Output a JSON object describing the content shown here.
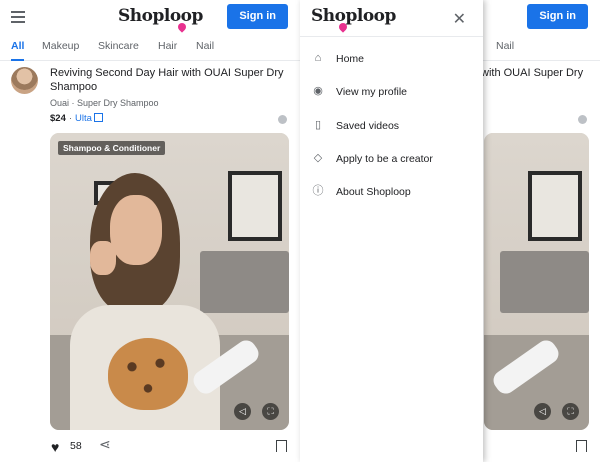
{
  "brand": {
    "logo_text": "Shoploop",
    "accent": "#1a73e8",
    "heart_color": "#e8318f"
  },
  "header": {
    "sign_in_label": "Sign in"
  },
  "tabs": [
    {
      "label": "All",
      "active": true
    },
    {
      "label": "Makeup"
    },
    {
      "label": "Skincare"
    },
    {
      "label": "Hair"
    },
    {
      "label": "Nail"
    }
  ],
  "product": {
    "title": "Reviving Second Day Hair with OUAI Super Dry Shampoo",
    "brand_line": "Ouai · Super Dry Shampoo",
    "price": "$24",
    "retailer": "Ulta",
    "video_label": "Shampoo & Conditioner",
    "likes": "58"
  },
  "right_panel": {
    "title_fragment": "with OUAI Super Dry",
    "tab_fragment": "Nail"
  },
  "drawer": {
    "items": [
      {
        "label": "Home",
        "icon": "home-icon"
      },
      {
        "label": "View my profile",
        "icon": "profile-icon"
      },
      {
        "label": "Saved videos",
        "icon": "saved-icon"
      },
      {
        "label": "Apply to be a creator",
        "icon": "tag-icon"
      },
      {
        "label": "About Shoploop",
        "icon": "info-icon"
      }
    ]
  }
}
